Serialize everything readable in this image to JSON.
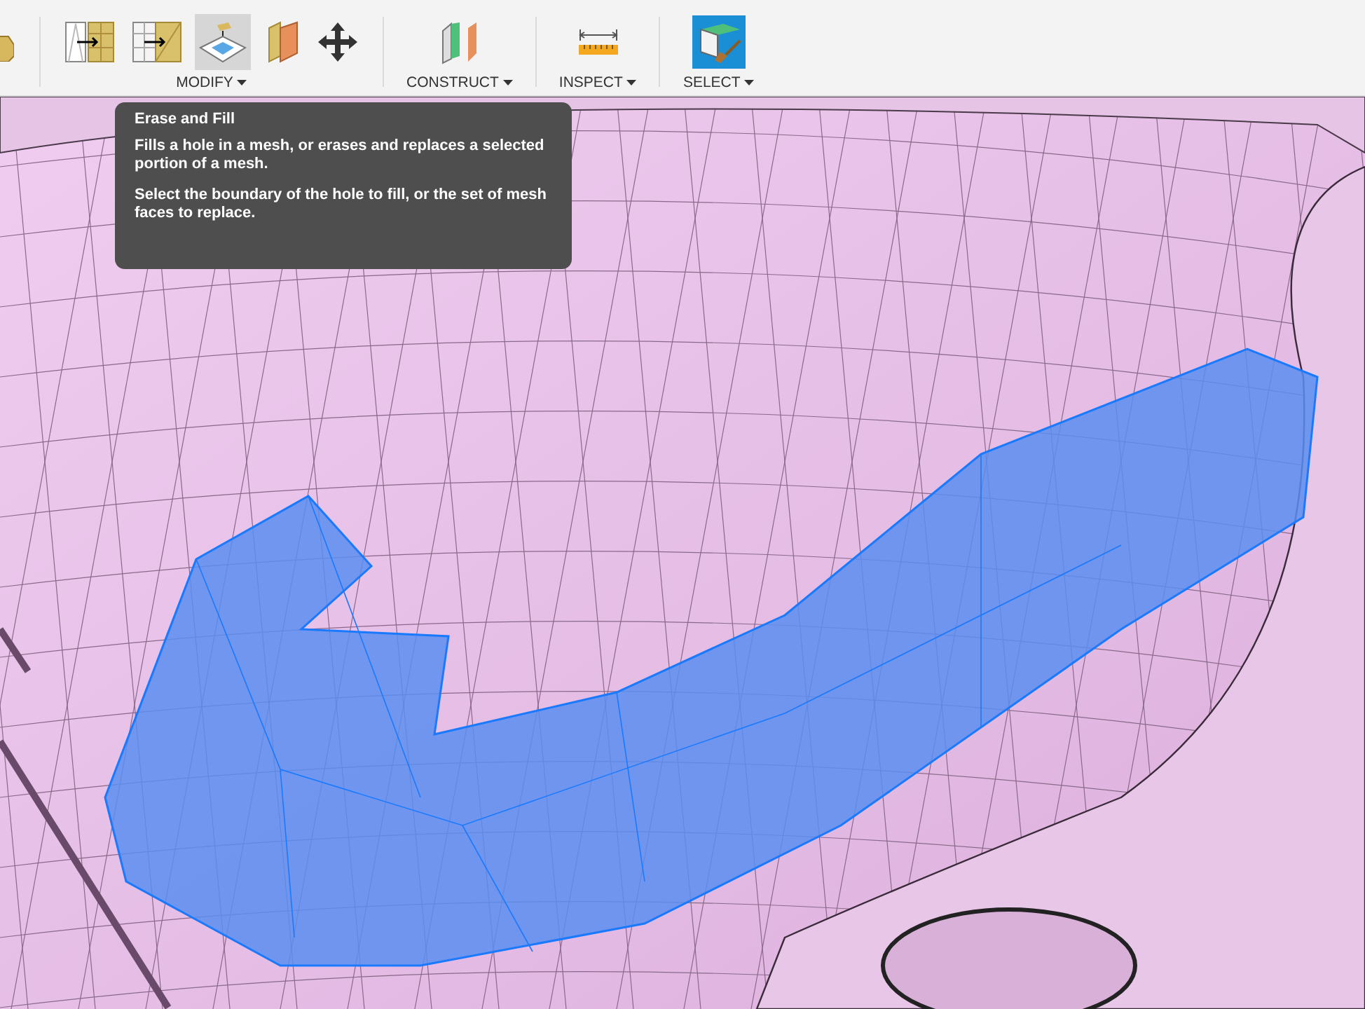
{
  "toolbar": {
    "groups": [
      {
        "label": "MODIFY",
        "tools": [
          {
            "kind": "split-mesh",
            "selected": false
          },
          {
            "kind": "split-mesh-grid",
            "selected": false
          },
          {
            "kind": "erase-fill",
            "selected": true
          },
          {
            "kind": "plane-cut",
            "selected": false
          },
          {
            "kind": "move",
            "selected": false
          }
        ]
      },
      {
        "label": "CONSTRUCT",
        "tools": [
          {
            "kind": "planes",
            "selected": false
          }
        ]
      },
      {
        "label": "INSPECT",
        "tools": [
          {
            "kind": "measure",
            "selected": false
          }
        ]
      },
      {
        "label": "SELECT",
        "tools": [
          {
            "kind": "select",
            "selected": false
          }
        ]
      }
    ]
  },
  "tooltip": {
    "title": "Erase and Fill",
    "paragraphs": [
      "Fills a hole in a mesh, or erases and replaces a selected portion of a mesh.",
      "Select the boundary of the hole to fill, or the set of mesh faces to replace."
    ]
  }
}
